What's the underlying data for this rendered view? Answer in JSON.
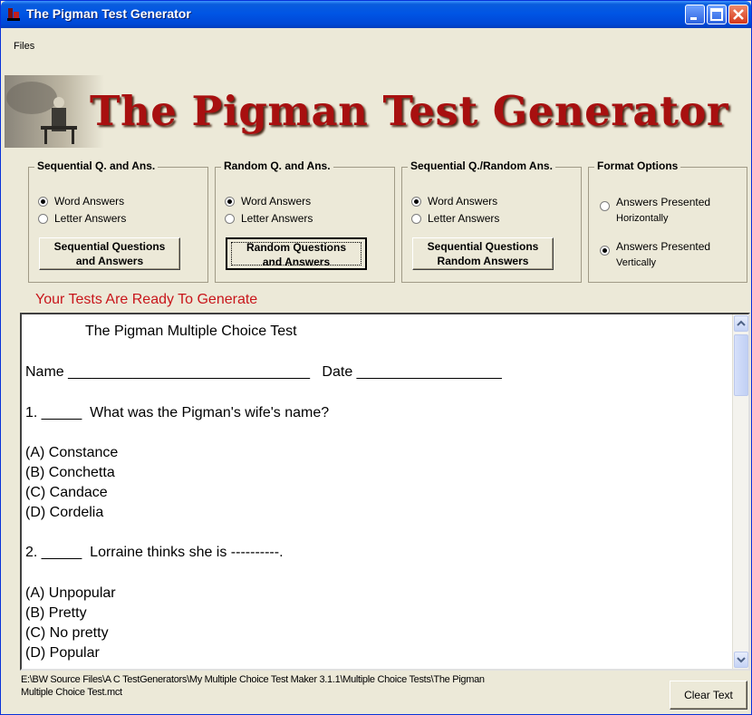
{
  "window": {
    "title": "The Pigman Test Generator"
  },
  "menu": {
    "files": "Files"
  },
  "banner": {
    "title": "The Pigman Test Generator"
  },
  "groups": [
    {
      "title": "Sequential Q. and Ans.",
      "options": [
        "Word Answers",
        "Letter Answers"
      ],
      "selected": 0,
      "button": "Sequential Questions\nand Answers"
    },
    {
      "title": "Random Q. and Ans.",
      "options": [
        "Word Answers",
        "Letter Answers"
      ],
      "selected": 0,
      "button": "Random Questions\nand Answers"
    },
    {
      "title": "Sequential Q./Random Ans.",
      "options": [
        "Word Answers",
        "Letter Answers"
      ],
      "selected": 0,
      "button": "Sequential Questions\nRandom Answers"
    }
  ],
  "format": {
    "title": "Format Options",
    "options": [
      {
        "line1": "Answers Presented",
        "line2": "Horizontally",
        "selected": false
      },
      {
        "line1": "Answers Presented",
        "line2": "Vertically",
        "selected": true
      }
    ]
  },
  "status": "Your Tests Are Ready To Generate",
  "document": {
    "heading": "The Pigman Multiple Choice Test",
    "name_line": "Name ______________________________   Date __________________",
    "q1": "1. _____  What was the Pigman's wife's name?",
    "q1_answers": [
      "(A) Constance",
      "(B) Conchetta",
      "(C) Candace",
      "(D) Cordelia"
    ],
    "q2": "2. _____  Lorraine thinks she is ----------.",
    "q2_answers": [
      "(A) Unpopular",
      "(B) Pretty",
      "(C) No pretty",
      "(D) Popular"
    ]
  },
  "footer": {
    "path_line1": "E:\\BW Source Files\\A C TestGenerators\\My Multiple Choice Test Maker 3.1.1\\Multiple Choice Tests\\The Pigman",
    "path_line2": "Multiple Choice Test.mct",
    "clear_button": "Clear Text"
  }
}
